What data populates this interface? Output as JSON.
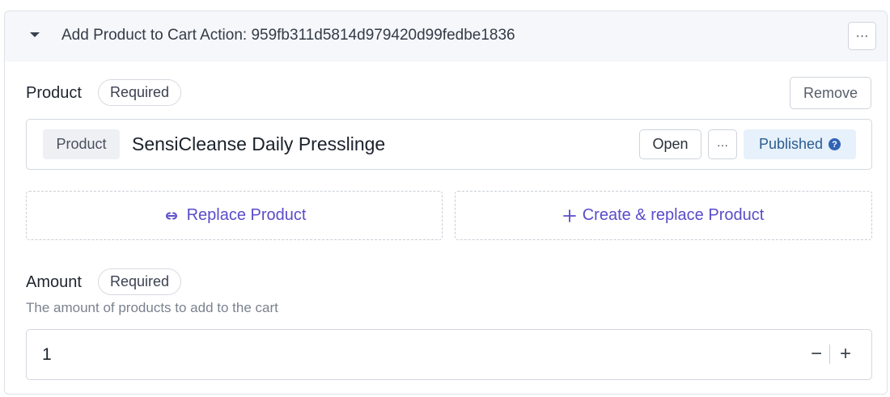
{
  "header": {
    "title": "Add Product to Cart Action: 959fb311d5814d979420d99fedbe1836",
    "menu_label": "···"
  },
  "product_field": {
    "label": "Product",
    "required_label": "Required",
    "remove_label": "Remove",
    "reference": {
      "type_label": "Product",
      "name": "SensiCleanse Daily Presslinge",
      "open_label": "Open",
      "menu_label": "···",
      "status": "Published",
      "status_help_glyph": "?"
    },
    "replace_label": "Replace Product",
    "create_replace_label": "Create & replace Product"
  },
  "amount_field": {
    "label": "Amount",
    "required_label": "Required",
    "description": "The amount of products to add to the cart",
    "value": "1",
    "decrement_glyph": "−",
    "increment_glyph": "+"
  },
  "colors": {
    "accent": "#5a4cc9",
    "status_bg": "#e6f1fb",
    "status_text": "#2b5c8f",
    "help_icon": "#2f63b5"
  },
  "icons": {
    "collapse": "chevron-down-icon",
    "replace": "link-icon",
    "create": "plus-icon",
    "help": "question-circle-icon"
  }
}
